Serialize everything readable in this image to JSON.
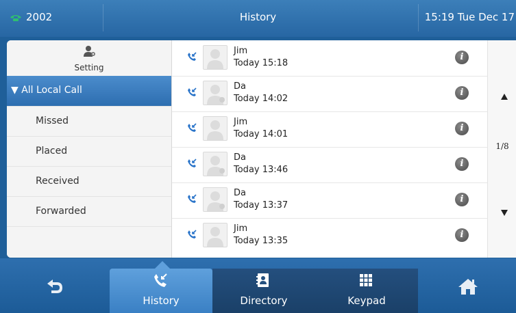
{
  "status_bar": {
    "extension": "2002",
    "title": "History",
    "clock": "15:19 Tue Dec 17"
  },
  "sidebar": {
    "setting_label": "Setting",
    "items": [
      {
        "label": "▼ All Local Call",
        "active": true
      },
      {
        "label": "Missed"
      },
      {
        "label": "Placed"
      },
      {
        "label": "Received"
      },
      {
        "label": "Forwarded"
      }
    ]
  },
  "calls": [
    {
      "name": "Jim",
      "time": "Today 15:18"
    },
    {
      "name": "Da",
      "time": "Today 14:02"
    },
    {
      "name": "Jim",
      "time": "Today 14:01"
    },
    {
      "name": "Da",
      "time": "Today 13:46"
    },
    {
      "name": "Da",
      "time": "Today 13:37"
    },
    {
      "name": "Jim",
      "time": "Today 13:35"
    }
  ],
  "pager": {
    "page": "1/8"
  },
  "bottom_nav": {
    "history": "History",
    "directory": "Directory",
    "keypad": "Keypad"
  },
  "colors": {
    "accent": "#2d6eb0",
    "status_icon": "#2fbf71",
    "call_icon": "#2a74c9"
  },
  "icons": {
    "status": "phone-icon",
    "setting": "user-gear-icon",
    "call": "received-call-icon",
    "info": "info-icon",
    "back": "back-icon",
    "home": "home-icon"
  }
}
